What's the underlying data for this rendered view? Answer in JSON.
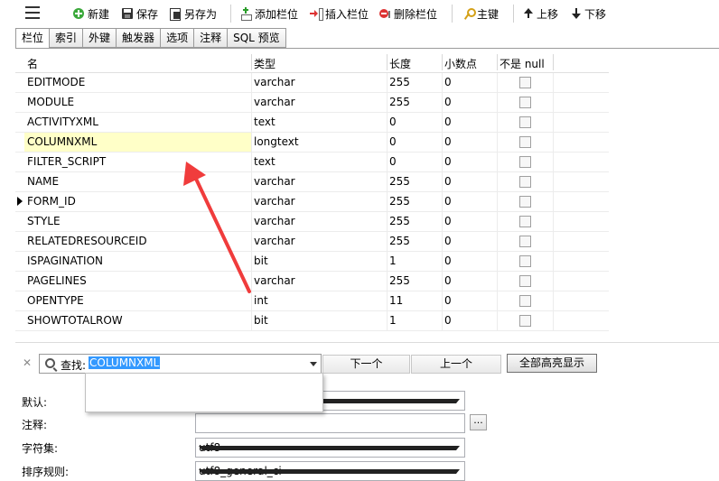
{
  "toolbar": {
    "new": "新建",
    "save": "保存",
    "save_as": "另存为",
    "add_field": "添加栏位",
    "insert_field": "插入栏位",
    "delete_field": "删除栏位",
    "primary_key": "主键",
    "move_up": "上移",
    "move_down": "下移"
  },
  "tabs": [
    "栏位",
    "索引",
    "外键",
    "触发器",
    "选项",
    "注释",
    "SQL 预览"
  ],
  "grid": {
    "headers": {
      "name": "名",
      "type": "类型",
      "length": "长度",
      "decimals": "小数点",
      "not_null": "不是 null"
    },
    "rows": [
      {
        "name": "EDITMODE",
        "type": "varchar",
        "length": "255",
        "decimals": "0"
      },
      {
        "name": "MODULE",
        "type": "varchar",
        "length": "255",
        "decimals": "0"
      },
      {
        "name": "ACTIVITYXML",
        "type": "text",
        "length": "0",
        "decimals": "0"
      },
      {
        "name": "COLUMNXML",
        "type": "longtext",
        "length": "0",
        "decimals": "0"
      },
      {
        "name": "FILTER_SCRIPT",
        "type": "text",
        "length": "0",
        "decimals": "0"
      },
      {
        "name": "NAME",
        "type": "varchar",
        "length": "255",
        "decimals": "0"
      },
      {
        "name": "FORM_ID",
        "type": "varchar",
        "length": "255",
        "decimals": "0"
      },
      {
        "name": "STYLE",
        "type": "varchar",
        "length": "255",
        "decimals": "0"
      },
      {
        "name": "RELATEDRESOURCEID",
        "type": "varchar",
        "length": "255",
        "decimals": "0"
      },
      {
        "name": "ISPAGINATION",
        "type": "bit",
        "length": "1",
        "decimals": "0"
      },
      {
        "name": "PAGELINES",
        "type": "varchar",
        "length": "255",
        "decimals": "0"
      },
      {
        "name": "OPENTYPE",
        "type": "int",
        "length": "11",
        "decimals": "0"
      },
      {
        "name": "SHOWTOTALROW",
        "type": "bit",
        "length": "1",
        "decimals": "0"
      }
    ]
  },
  "search": {
    "label": "查找:",
    "value": "COLUMNXML",
    "next": "下一个",
    "prev": "上一个",
    "highlight_all": "全部高亮显示"
  },
  "properties": {
    "default_label": "默认:",
    "comment_label": "注释:",
    "ellipsis": "...",
    "charset_label": "字符集:",
    "charset_value": "utf8",
    "collation_label": "排序规则:",
    "collation_value": "utf8_general_ci"
  },
  "colors": {
    "selected_row": "#ffffc8",
    "annotation_arrow": "#f03c3c",
    "search_highlight": "#3399ff"
  }
}
